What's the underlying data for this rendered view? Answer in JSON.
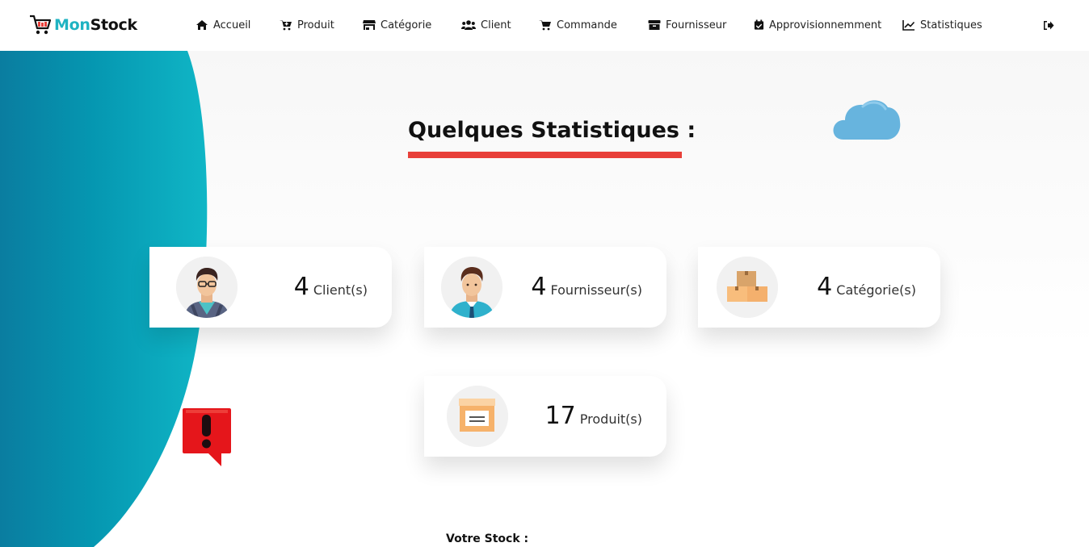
{
  "brand": {
    "name_part1": "Mon",
    "name_part2": "Stock",
    "icon": "shopping-cart-icon"
  },
  "nav": {
    "items": [
      {
        "label": "Accueil",
        "icon": "home-icon"
      },
      {
        "label": "Produit",
        "icon": "cart-plus-icon"
      },
      {
        "label": "Catégorie",
        "icon": "store-icon"
      },
      {
        "label": "Client",
        "icon": "users-icon"
      },
      {
        "label": "Commande",
        "icon": "shopping-cart-icon"
      },
      {
        "label": "Fournisseur",
        "icon": "box-icon"
      },
      {
        "label": "Approvisionnemment",
        "icon": "calendar-check-icon"
      },
      {
        "label": "Statistiques",
        "icon": "chart-line-icon"
      }
    ],
    "logout_icon": "sign-out-icon"
  },
  "main": {
    "title": "Quelques Statistiques :",
    "stats": [
      {
        "value": "4",
        "label": "Client(s)",
        "icon": "client-avatar-icon"
      },
      {
        "value": "4",
        "label": "Fournisseur(s)",
        "icon": "supplier-avatar-icon"
      },
      {
        "value": "4",
        "label": "Catégorie(s)",
        "icon": "boxes-icon"
      },
      {
        "value": "17",
        "label": "Produit(s)",
        "icon": "archive-box-icon"
      }
    ],
    "stock_title": "Votre Stock :"
  },
  "colors": {
    "accent": "#1fb3c2",
    "underline": "#e8403a",
    "wave_dark": "#0a7da0",
    "wave_light": "#10b6c6",
    "alert": "#e5161b",
    "cloud": "#67b4de"
  }
}
